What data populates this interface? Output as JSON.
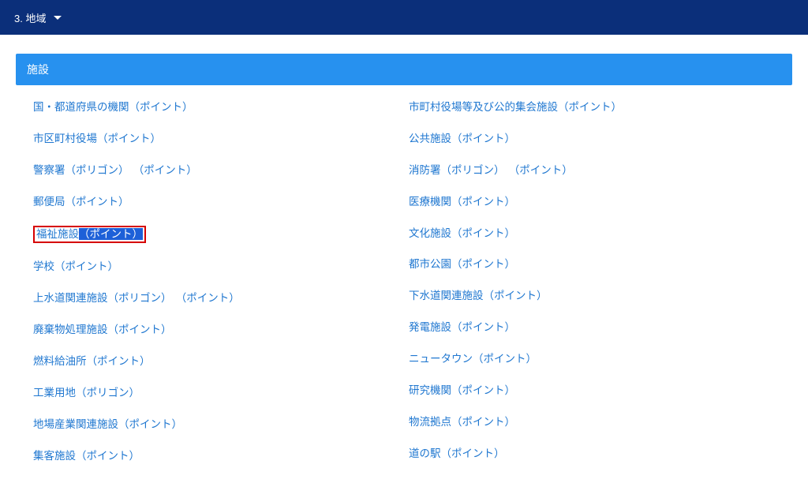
{
  "topbar": {
    "label": "3. 地域"
  },
  "section_title": "施設",
  "highlight": {
    "text_plain": "福祉施設",
    "text_selected": "（ポイント）"
  },
  "rows_left": [
    [
      {
        "label": "国・都道府県の機関（ポイント）"
      }
    ],
    [
      {
        "label": "市区町村役場（ポイント）"
      }
    ],
    [
      {
        "label": "警察署（ポリゴン）"
      },
      {
        "label": "（ポイント）"
      }
    ],
    [
      {
        "label": "郵便局（ポイント）"
      }
    ],
    [],
    [
      {
        "label": "学校（ポイント）"
      }
    ],
    [
      {
        "label": "上水道関連施設（ポリゴン）"
      },
      {
        "label": "（ポイント）"
      }
    ],
    [
      {
        "label": "廃棄物処理施設（ポイント）"
      }
    ],
    [
      {
        "label": "燃料給油所（ポイント）"
      }
    ],
    [
      {
        "label": "工業用地（ポリゴン）"
      }
    ],
    [
      {
        "label": "地場産業関連施設（ポイント）"
      }
    ],
    [
      {
        "label": "集客施設（ポイント）"
      }
    ]
  ],
  "rows_right": [
    [
      {
        "label": "市町村役場等及び公的集会施設（ポイント）"
      }
    ],
    [
      {
        "label": "公共施設（ポイント）"
      }
    ],
    [
      {
        "label": "消防署（ポリゴン）"
      },
      {
        "label": "（ポイント）"
      }
    ],
    [
      {
        "label": "医療機関（ポイント）"
      }
    ],
    [
      {
        "label": "文化施設（ポイント）"
      }
    ],
    [
      {
        "label": "都市公園（ポイント）"
      }
    ],
    [
      {
        "label": "下水道関連施設（ポイント）"
      }
    ],
    [
      {
        "label": "発電施設（ポイント）"
      }
    ],
    [
      {
        "label": "ニュータウン（ポイント）"
      }
    ],
    [
      {
        "label": "研究機関（ポイント）"
      }
    ],
    [
      {
        "label": "物流拠点（ポイント）"
      }
    ],
    [
      {
        "label": "道の駅（ポイント）"
      }
    ]
  ]
}
